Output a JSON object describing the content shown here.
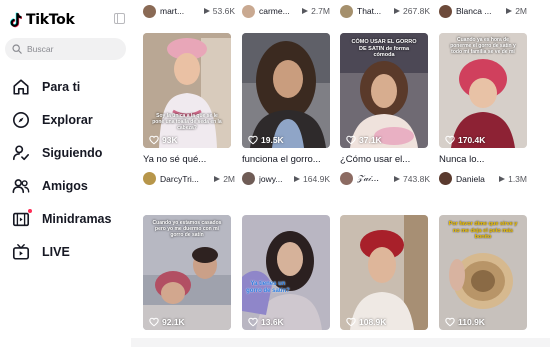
{
  "sidebar": {
    "logo_text": "TikTok",
    "search_placeholder": "Buscar",
    "nav": [
      {
        "label": "Para ti",
        "icon": "home-icon"
      },
      {
        "label": "Explorar",
        "icon": "compass-icon"
      },
      {
        "label": "Siguiendo",
        "icon": "following-icon"
      },
      {
        "label": "Amigos",
        "icon": "friends-icon"
      },
      {
        "label": "Minidramas",
        "icon": "minidramas-icon"
      },
      {
        "label": "LIVE",
        "icon": "live-tv-icon"
      }
    ]
  },
  "top_row": [
    {
      "author": "mart...",
      "plays": "53.6K"
    },
    {
      "author": "carme...",
      "plays": "2.7M"
    },
    {
      "author": "That...",
      "plays": "267.8K"
    },
    {
      "author": "Blanca ...",
      "plays": "2M"
    }
  ],
  "row1": [
    {
      "likes": "93K",
      "caption": "Ya no sé qué...",
      "author": "DarcyTri...",
      "plays": "2M",
      "overlay": "Soy la única a la que se le pone una toalla de seda en la cabeza?"
    },
    {
      "likes": "19.5K",
      "caption": "funciona el gorro...",
      "author": "jowy...",
      "plays": "164.9K",
      "overlay": ""
    },
    {
      "likes": "37.1K",
      "caption": "¿Cómo usar el...",
      "author": "𝒵𝒶𝒾...",
      "plays": "743.8K",
      "overlay": "CÓMO USAR EL GORRO DE SATIN de forma cómoda"
    },
    {
      "likes": "170.4K",
      "caption": "Nunca lo...",
      "author": "Daniela",
      "plays": "1.3M",
      "overlay": "Cuando ya es hora de ponerme el gorro de satín y todo mi familia se ve de mi"
    }
  ],
  "row2": [
    {
      "likes": "92.1K",
      "overlay": "Cuando yo estamos casados pero yo me duermo con mi gorro de satín"
    },
    {
      "likes": "13.6K",
      "overlay": "Ya tienes un gorro de satín?"
    },
    {
      "likes": "108.9K",
      "overlay": ""
    },
    {
      "likes": "110.9K",
      "overlay": "Por favor dime que sirve y no me deja el pelo más bonito"
    }
  ],
  "colors": {
    "brand_red": "#fe2c55",
    "brand_cyan": "#25f4ee",
    "text": "#161823",
    "muted": "#57585e"
  }
}
